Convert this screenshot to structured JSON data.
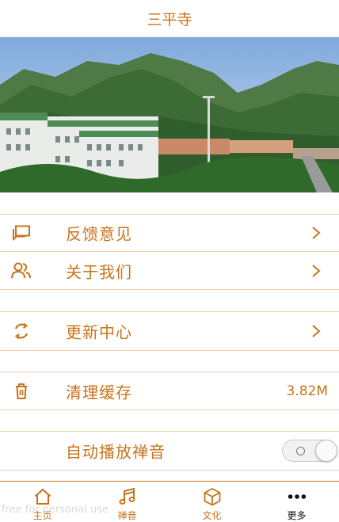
{
  "header": {
    "title": "三平寺"
  },
  "banner": {
    "image": "temple-landscape-photo"
  },
  "menu": {
    "feedback": {
      "label": "反馈意见",
      "icon": "chat-icon"
    },
    "about": {
      "label": "关于我们",
      "icon": "users-icon"
    },
    "update": {
      "label": "更新中心",
      "icon": "refresh-icon"
    },
    "cache": {
      "label": "清理缓存",
      "value": "3.82M",
      "icon": "trash-icon"
    },
    "autoplay": {
      "label": "自动播放禅音",
      "toggle_on": false
    }
  },
  "tabbar": {
    "tabs": [
      {
        "label": "主页",
        "icon": "home-icon"
      },
      {
        "label": "禅音",
        "icon": "music-icon"
      },
      {
        "label": "文化",
        "icon": "cube-icon"
      },
      {
        "label": "更多",
        "icon": "more-dots-icon"
      }
    ]
  },
  "watermark": "free for personal use",
  "colors": {
    "accent": "#c8731a",
    "divider": "#f0d2ad",
    "text_dark": "#111111"
  }
}
